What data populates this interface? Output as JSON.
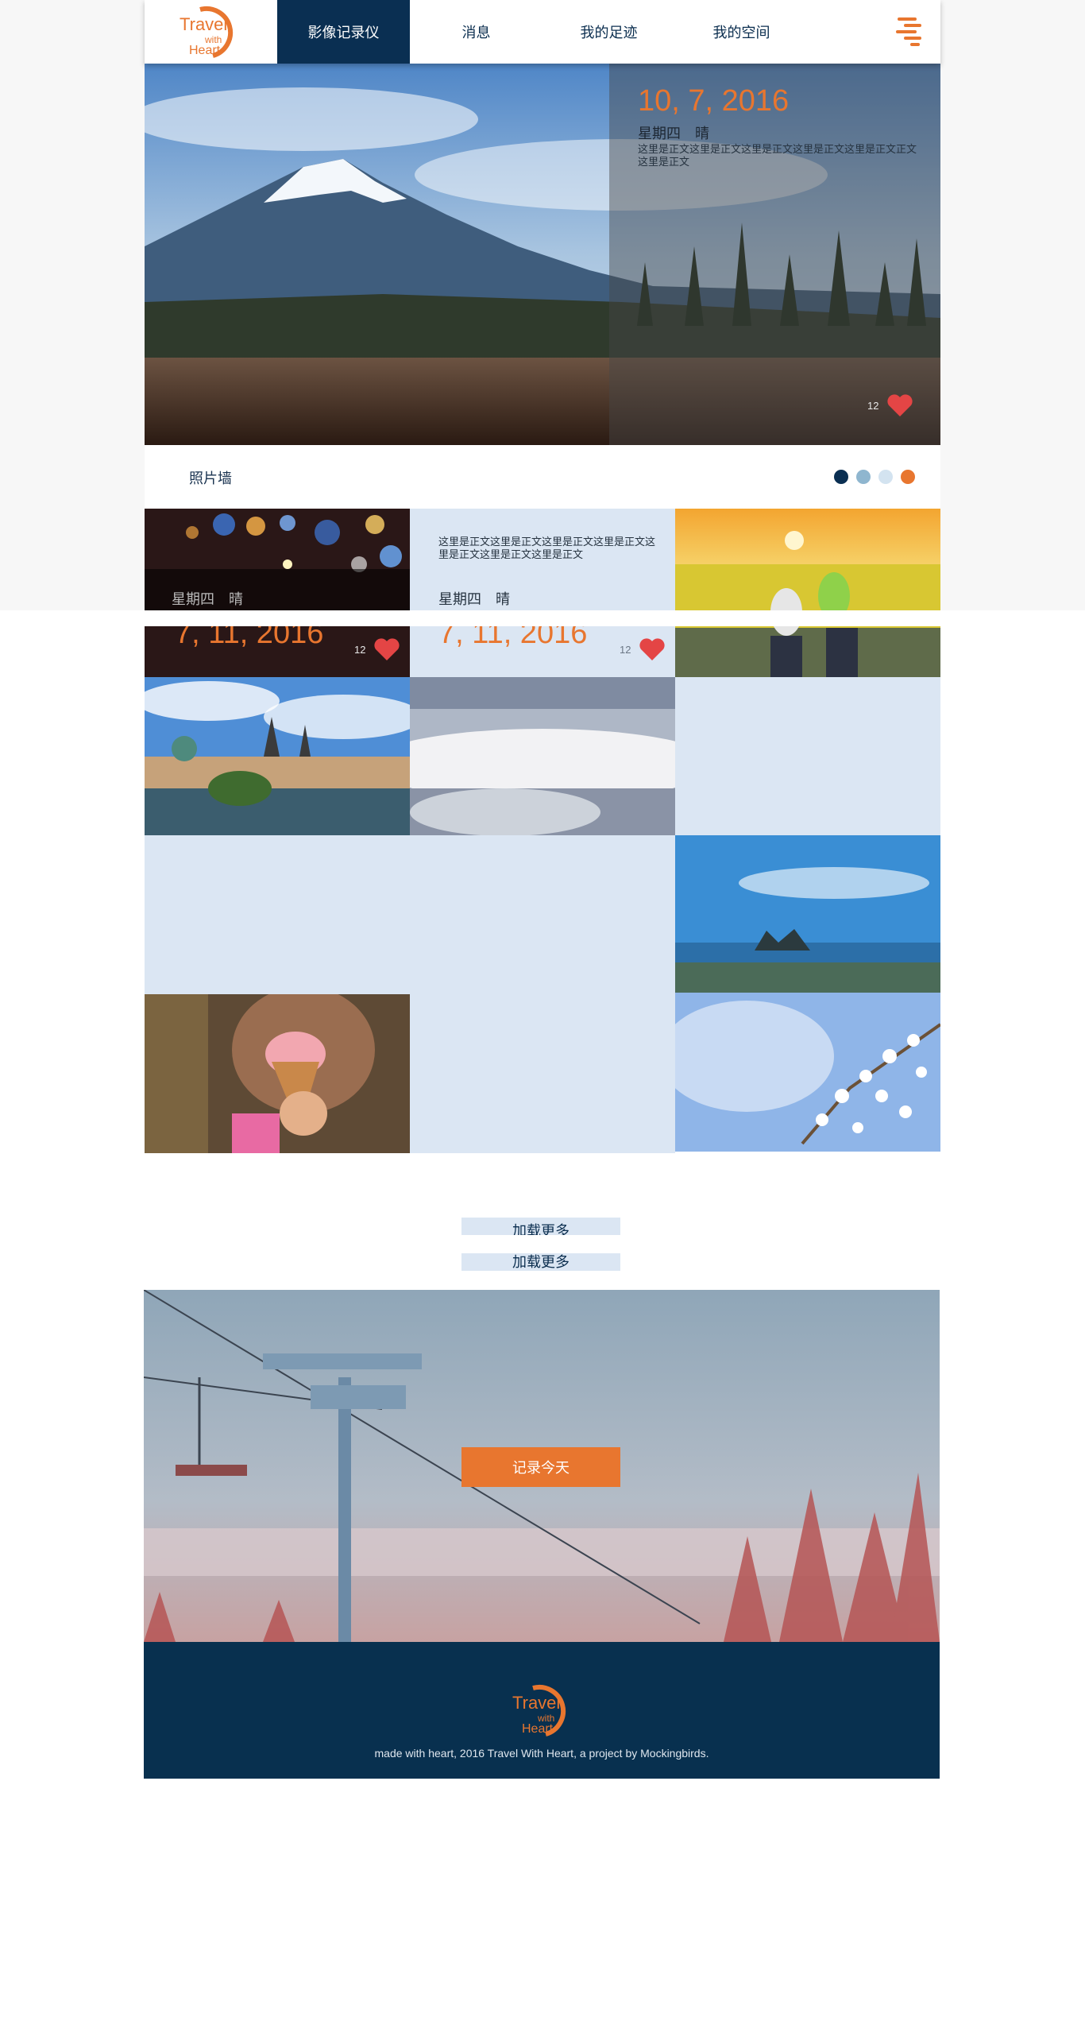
{
  "brand": {
    "logo_line1": "Travel",
    "logo_line2": "with",
    "logo_line3": "Heart"
  },
  "nav": {
    "items": [
      {
        "label": "影像记录仪",
        "active": true
      },
      {
        "label": "消息",
        "active": false
      },
      {
        "label": "我的足迹",
        "active": false
      },
      {
        "label": "我的空间",
        "active": false
      }
    ],
    "menu_icon": "menu-lines-icon"
  },
  "hero": {
    "date": "10, 7, 2016",
    "day": "星期四　晴",
    "body": "这里是正文这里是正文这里是正文这里是正文这里是正文正文这里是正文",
    "likes": "12"
  },
  "photo_wall": {
    "title": "照片墙",
    "dots": [
      "#0a2f52",
      "#8fb6cf",
      "#d3e3f0",
      "#e8762f"
    ]
  },
  "cards": [
    {
      "day": "星期四　晴",
      "date": "7, 11, 2016",
      "likes": "12"
    },
    {
      "body": "这里是正文这里是正文这里是正文这里是正文这里是正文这里是正文这里是正文",
      "day": "星期四　晴",
      "date": "7, 11, 2016",
      "likes": "12"
    }
  ],
  "load_more": {
    "label": "加载更多"
  },
  "cta": {
    "label": "记录今天"
  },
  "footer": {
    "text": "made with heart, 2016 Travel With Heart, a project by Mockingbirds."
  },
  "colors": {
    "accent": "#e8762f",
    "navy": "#0a2f52",
    "light_blue": "#dbe6f3"
  }
}
